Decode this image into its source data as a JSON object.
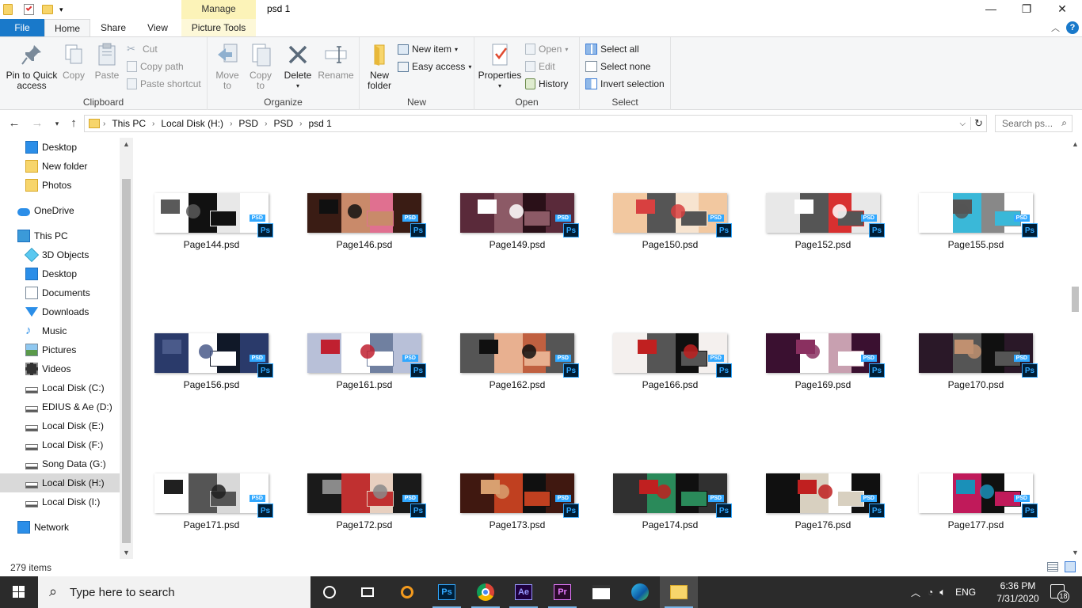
{
  "window": {
    "title": "psd 1",
    "manage_label": "Manage",
    "minimize_glyph": "—",
    "maximize_glyph": "❐",
    "close_glyph": "✕"
  },
  "tabs": {
    "file": "File",
    "home": "Home",
    "share": "Share",
    "view": "View",
    "picture_tools": "Picture Tools"
  },
  "ribbon": {
    "clipboard": {
      "label": "Clipboard",
      "pin": "Pin to Quick access",
      "copy": "Copy",
      "paste": "Paste",
      "cut": "Cut",
      "copy_path": "Copy path",
      "paste_shortcut": "Paste shortcut"
    },
    "organize": {
      "label": "Organize",
      "move_to": "Move to",
      "copy_to": "Copy to",
      "delete": "Delete",
      "rename": "Rename"
    },
    "new": {
      "label": "New",
      "new_folder": "New folder",
      "new_item": "New item",
      "easy_access": "Easy access"
    },
    "open": {
      "label": "Open",
      "properties": "Properties",
      "open": "Open",
      "edit": "Edit",
      "history": "History"
    },
    "select": {
      "label": "Select",
      "select_all": "Select all",
      "select_none": "Select none",
      "invert": "Invert selection"
    }
  },
  "address": {
    "crumbs": [
      "This PC",
      "Local Disk (H:)",
      "PSD",
      "PSD",
      "psd 1"
    ],
    "search_placeholder": "Search ps..."
  },
  "nav": {
    "items": [
      {
        "label": "Desktop",
        "icon": "desktop-icon"
      },
      {
        "label": "New folder",
        "icon": "folder-icon"
      },
      {
        "label": "Photos",
        "icon": "folder-icon"
      },
      {
        "label": "OneDrive",
        "icon": "cloud-icon"
      },
      {
        "label": "This PC",
        "icon": "computer-icon"
      },
      {
        "label": "3D Objects",
        "icon": "cube-icon"
      },
      {
        "label": "Desktop",
        "icon": "desktop-icon"
      },
      {
        "label": "Documents",
        "icon": "document-icon"
      },
      {
        "label": "Downloads",
        "icon": "download-icon"
      },
      {
        "label": "Music",
        "icon": "music-icon"
      },
      {
        "label": "Pictures",
        "icon": "pictures-icon"
      },
      {
        "label": "Videos",
        "icon": "video-icon"
      },
      {
        "label": "Local Disk (C:)",
        "icon": "drive-icon"
      },
      {
        "label": "EDIUS & Ae (D:)",
        "icon": "drive-icon"
      },
      {
        "label": "Local Disk (E:)",
        "icon": "drive-icon"
      },
      {
        "label": "Local Disk (F:)",
        "icon": "drive-icon"
      },
      {
        "label": "Song Data (G:)",
        "icon": "drive-icon"
      },
      {
        "label": "Local Disk (H:)",
        "icon": "drive-icon",
        "selected": true
      },
      {
        "label": "Local Disk (I:)",
        "icon": "drive-icon"
      },
      {
        "label": "Network",
        "icon": "network-icon"
      }
    ]
  },
  "files": [
    {
      "name": "Page144.psd",
      "palette": [
        "#ffffff",
        "#111111",
        "#5a5a5a",
        "#e8e8e8"
      ]
    },
    {
      "name": "Page146.psd",
      "palette": [
        "#3a1c14",
        "#c98a6a",
        "#101010",
        "#e07090"
      ]
    },
    {
      "name": "Page149.psd",
      "palette": [
        "#5a2a3a",
        "#8c5a66",
        "#ffffff",
        "#2a1018"
      ]
    },
    {
      "name": "Page150.psd",
      "palette": [
        "#f2c8a0",
        "#555555",
        "#d84040",
        "#f7e4d0"
      ]
    },
    {
      "name": "Page152.psd",
      "palette": [
        "#e8e8e8",
        "#555555",
        "#ffffff",
        "#d83030"
      ]
    },
    {
      "name": "Page155.psd",
      "palette": [
        "#ffffff",
        "#3ab8d8",
        "#555555",
        "#888888"
      ]
    },
    {
      "name": "Page156.psd",
      "palette": [
        "#2a3a6a",
        "#ffffff",
        "#4a5a8a",
        "#101828"
      ]
    },
    {
      "name": "Page161.psd",
      "palette": [
        "#b8c0d8",
        "#ffffff",
        "#c02030",
        "#7080a0"
      ]
    },
    {
      "name": "Page162.psd",
      "palette": [
        "#555555",
        "#e8b090",
        "#101010",
        "#c06040"
      ]
    },
    {
      "name": "Page166.psd",
      "palette": [
        "#f4f0ee",
        "#555555",
        "#c02020",
        "#101010"
      ]
    },
    {
      "name": "Page169.psd",
      "palette": [
        "#3a1030",
        "#ffffff",
        "#8a3060",
        "#c8a0b0"
      ]
    },
    {
      "name": "Page170.psd",
      "palette": [
        "#2a1828",
        "#555555",
        "#c09070",
        "#101010"
      ]
    },
    {
      "name": "Page171.psd",
      "palette": [
        "#ffffff",
        "#555555",
        "#202020",
        "#d8d8d8"
      ]
    },
    {
      "name": "Page172.psd",
      "palette": [
        "#1a1a1a",
        "#c03030",
        "#8a8a8a",
        "#e8d0c0"
      ]
    },
    {
      "name": "Page173.psd",
      "palette": [
        "#401810",
        "#c04020",
        "#d8a070",
        "#101010"
      ]
    },
    {
      "name": "Page174.psd",
      "palette": [
        "#303030",
        "#2a8a5a",
        "#c02020",
        "#101010"
      ]
    },
    {
      "name": "Page176.psd",
      "palette": [
        "#101010",
        "#d8d0c0",
        "#c02020",
        "#ffffff"
      ]
    },
    {
      "name": "Page177.psd",
      "palette": [
        "#ffffff",
        "#c01a5a",
        "#1a90b8",
        "#101010"
      ]
    }
  ],
  "file_badge": {
    "psd": "PSD",
    "ps": "Ps"
  },
  "status": {
    "item_count": "279 items"
  },
  "taskbar": {
    "search_text": "Type here to search",
    "lang": "ENG",
    "time": "6:36 PM",
    "date": "7/31/2020",
    "notification_count": "18"
  },
  "colors": {
    "accent": "#1979ca",
    "selection": "#d9d9d9",
    "manage_tab": "#fcf3b8",
    "taskbar": "#2b2b2b"
  }
}
